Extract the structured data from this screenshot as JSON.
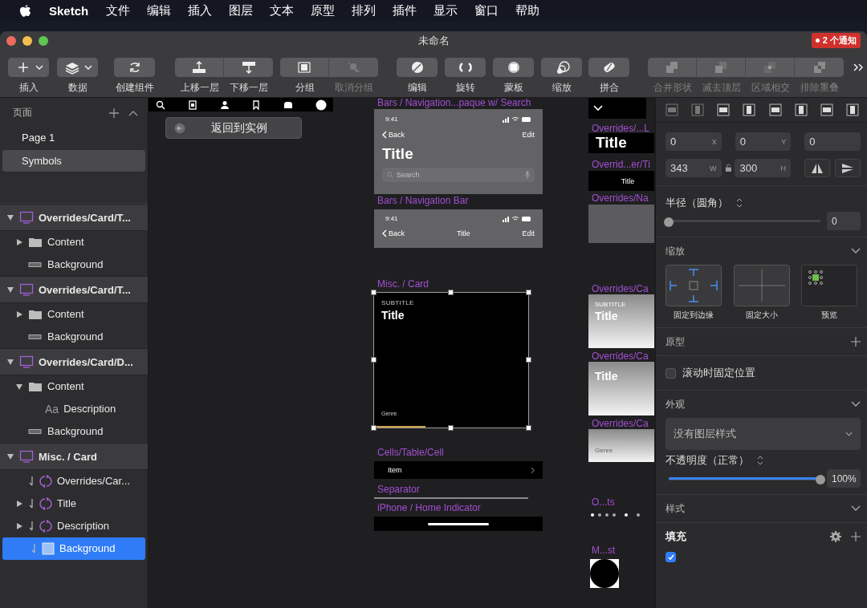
{
  "menu_bar": {
    "app_name": "Sketch",
    "items": [
      "文件",
      "编辑",
      "插入",
      "图层",
      "文本",
      "原型",
      "排列",
      "插件",
      "显示",
      "窗口",
      "帮助"
    ]
  },
  "window": {
    "title": "未命名",
    "notification": "2 个通知"
  },
  "toolbar": {
    "groups": [
      {
        "buttons": [
          {
            "label": "插入",
            "dropdown": true,
            "disabled": false
          }
        ]
      },
      {
        "buttons": [
          {
            "label": "数据",
            "dropdown": true,
            "disabled": false
          }
        ]
      },
      {
        "buttons": [
          {
            "label": "创建组件",
            "disabled": false
          }
        ]
      },
      {
        "buttons": [
          {
            "label": "上移一层",
            "disabled": false
          },
          {
            "label": "下移一层",
            "disabled": false
          }
        ]
      },
      {
        "buttons": [
          {
            "label": "分组",
            "disabled": false
          },
          {
            "label": "取消分组",
            "disabled": true
          }
        ]
      },
      {
        "buttons": [
          {
            "label": "编辑",
            "disabled": false
          }
        ]
      },
      {
        "buttons": [
          {
            "label": "旋转",
            "disabled": false
          }
        ]
      },
      {
        "buttons": [
          {
            "label": "蒙板",
            "disabled": false
          }
        ]
      },
      {
        "buttons": [
          {
            "label": "缩放",
            "disabled": false
          }
        ]
      },
      {
        "buttons": [
          {
            "label": "拼合",
            "disabled": false
          }
        ]
      },
      {
        "buttons": [
          {
            "label": "合并形状",
            "disabled": true
          },
          {
            "label": "减去顶层",
            "disabled": true
          },
          {
            "label": "区域相交",
            "disabled": true
          },
          {
            "label": "排除重叠",
            "disabled": true
          }
        ]
      }
    ]
  },
  "pages": {
    "title": "页面",
    "items": [
      {
        "label": "Page 1",
        "selected": false
      },
      {
        "label": "Symbols",
        "selected": true
      }
    ]
  },
  "layers": [
    {
      "label": "Overrides/Card/T...",
      "kind": "artboard",
      "expanded": true,
      "selected": false,
      "children": [
        {
          "label": "Content",
          "kind": "folder",
          "expanded": false,
          "selected": false
        },
        {
          "label": "Background",
          "kind": "shape",
          "selected": false
        }
      ]
    },
    {
      "label": "Overrides/Card/T...",
      "kind": "artboard",
      "expanded": true,
      "selected": false,
      "children": [
        {
          "label": "Content",
          "kind": "folder",
          "expanded": false,
          "selected": false
        },
        {
          "label": "Background",
          "kind": "shape",
          "selected": false
        }
      ]
    },
    {
      "label": "Overrides/Card/D...",
      "kind": "artboard",
      "expanded": true,
      "selected": false,
      "children": [
        {
          "label": "Content",
          "kind": "folder",
          "expanded": true,
          "selected": false,
          "children": [
            {
              "label": "Description",
              "kind": "text",
              "icon_text": "Aa",
              "selected": false
            }
          ]
        },
        {
          "label": "Background",
          "kind": "shape",
          "selected": false
        }
      ]
    },
    {
      "label": "Misc. / Card",
      "kind": "artboard",
      "expanded": true,
      "selected": false,
      "children": [
        {
          "label": "Overrides/Car...",
          "kind": "symbol",
          "masked": true,
          "selected": false
        },
        {
          "label": "Title",
          "kind": "symbol",
          "masked": true,
          "expanded": false,
          "selected": false
        },
        {
          "label": "Description",
          "kind": "symbol",
          "masked": true,
          "expanded": false,
          "selected": false
        },
        {
          "label": "Background",
          "kind": "rect",
          "masked": true,
          "selected": true
        }
      ]
    }
  ],
  "canvas": {
    "back_button": "返回到实例",
    "artboards": [
      {
        "label": "Bars / Navigation...paque w/ Search",
        "kind": "large_nav",
        "time": "9:41",
        "back": "Back",
        "edit": "Edit",
        "title": "Title",
        "search": "Search",
        "selected": false
      },
      {
        "label": "Bars / Navigation Bar",
        "kind": "nav",
        "time": "9:41",
        "back": "Back",
        "title": "Title",
        "edit": "Edit",
        "selected": false
      },
      {
        "label": "Misc. / Card",
        "kind": "card",
        "subtitle": "SUBTITLE",
        "title": "Title",
        "genre": "Genre",
        "selected": true
      },
      {
        "label": "Cells/Table/Cell",
        "kind": "cell",
        "item": "Item",
        "selected": false
      },
      {
        "label": "Separator",
        "kind": "separator",
        "selected": false
      },
      {
        "label": "iPhone / Home Indicator",
        "kind": "home_indicator",
        "selected": false
      }
    ],
    "side_artboards": [
      {
        "kind": "chevron"
      },
      {
        "label": "Overrides/...L",
        "kind": "title_large",
        "title": "Title"
      },
      {
        "label": "Overrid...er/Ti",
        "kind": "title_small",
        "title": "Title"
      },
      {
        "label": "Overrides/Na",
        "kind": "grey"
      },
      {
        "label": "Overrides/Ca",
        "kind": "gradient",
        "subtitle": "SUBTITLE",
        "title": "Title"
      },
      {
        "label": "Overrides/Ca",
        "kind": "gradient",
        "title": "Title"
      },
      {
        "label": "Overrides/Ca",
        "kind": "gradient",
        "genre": "Genre"
      },
      {
        "label": "O...ts",
        "kind": "dots"
      },
      {
        "label": "M...st",
        "kind": "mask"
      }
    ]
  },
  "inspector": {
    "position": [
      {
        "value": "0",
        "axis": "X"
      },
      {
        "value": "0",
        "axis": "Y"
      },
      {
        "value": "0"
      }
    ],
    "size": [
      {
        "value": "343",
        "axis": "W"
      },
      {
        "value": "300",
        "axis": "H"
      }
    ],
    "radius": {
      "label": "半径（圆角）",
      "level": 0,
      "value": "0"
    },
    "resizing": {
      "title": "缩放",
      "options": [
        "固定到边缘",
        "固定大小",
        "预览"
      ]
    },
    "prototyping": {
      "title": "原型",
      "fix_position": {
        "label": "滚动时固定位置",
        "checked": false
      }
    },
    "appearance": {
      "title": "外观",
      "style": "没有图层样式",
      "opacity": {
        "label": "不透明度（正常）",
        "level": 1,
        "value": "100%"
      }
    },
    "style": {
      "title": "样式"
    },
    "fills": {
      "title": "填充",
      "items": [
        {
          "checked": true
        }
      ]
    }
  }
}
